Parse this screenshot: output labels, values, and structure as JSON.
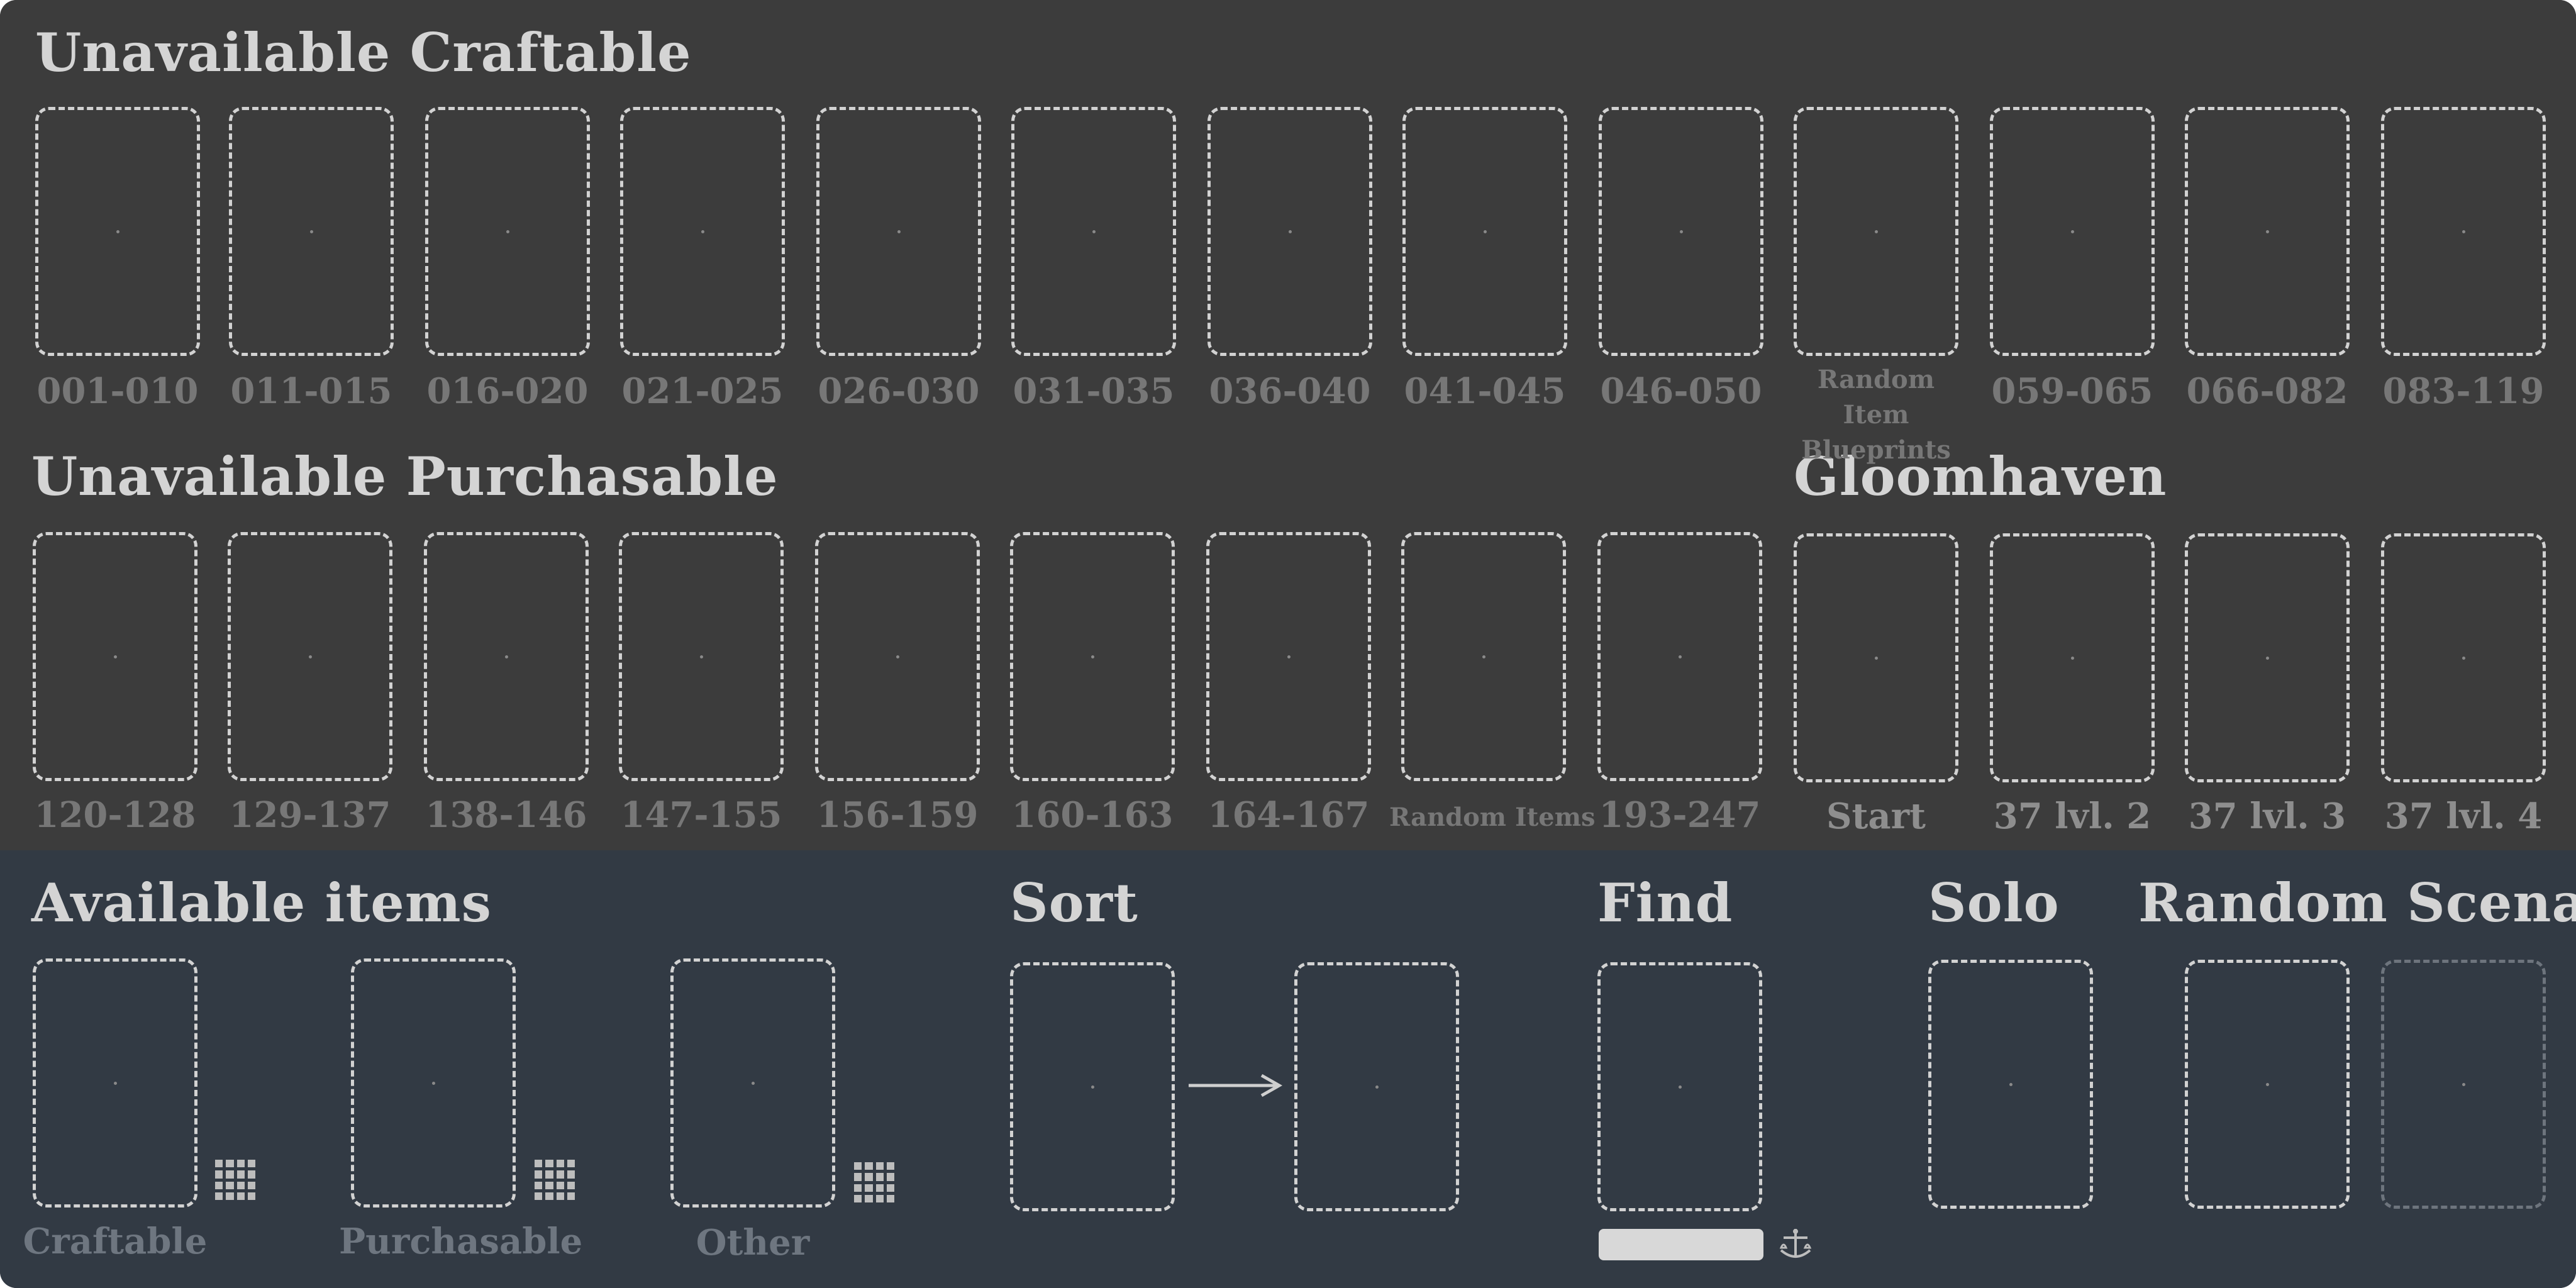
{
  "sections": {
    "unavailable_craftable": "Unavailable Craftable",
    "unavailable_purchasable": "Unavailable Purchasable",
    "gloomhaven": "Gloomhaven",
    "available_items": "Available items",
    "sort": "Sort",
    "find": "Find",
    "solo": "Solo",
    "random_scenarios": "Random Scenarios"
  },
  "craftable_labels": [
    "001-010",
    "011-015",
    "016-020",
    "021-025",
    "026-030",
    "031-035",
    "036-040",
    "041-045",
    "046-050",
    "Random Item Blueprints",
    "059-065",
    "066-082",
    "083-119"
  ],
  "purchasable_labels": [
    "120-128",
    "129-137",
    "138-146",
    "147-155",
    "156-159",
    "160-163",
    "164-167",
    "Random Items",
    "193-247"
  ],
  "gloomhaven_labels": [
    "Start",
    "37 lvl. 2",
    "37 lvl. 3",
    "37 lvl. 4"
  ],
  "available_labels": [
    "Craftable",
    "Purchasable",
    "Other"
  ],
  "find": {
    "placeholder": ""
  },
  "icons": {
    "grid": "grid-icon",
    "arrow": "arrow-right-icon",
    "scale": "scale-icon"
  },
  "colors": {
    "top_bg": "#3c3c3c",
    "bottom_bg": "#323a44",
    "heading": "#d4d4d4",
    "slot_border": "#d2d2d2"
  }
}
